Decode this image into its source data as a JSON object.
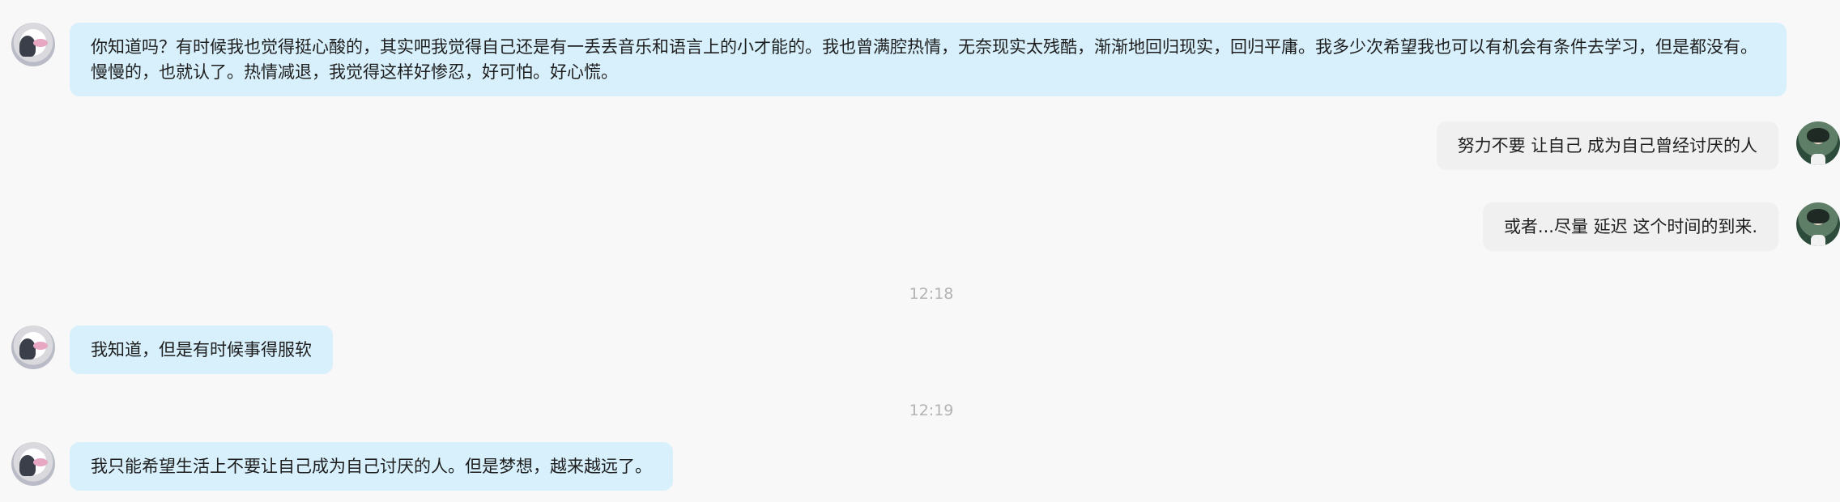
{
  "messages": [
    {
      "side": "left",
      "text": "你知道吗？有时候我也觉得挺心酸的，其实吧我觉得自己还是有一丢丢音乐和语言上的小才能的。我也曾满腔热情，无奈现实太残酷，渐渐地回归现实，回归平庸。我多少次希望我也可以有机会有条件去学习，但是都没有。慢慢的，也就认了。热情减退，我觉得这样好惨忍，好可怕。好心慌。"
    },
    {
      "side": "right",
      "text": "努力不要 让自己 成为自己曾经讨厌的人"
    },
    {
      "side": "right",
      "text": "或者...尽量 延迟 这个时间的到来."
    },
    {
      "side": "left",
      "text": "我知道，但是有时候事得服软"
    },
    {
      "side": "left",
      "text": "我只能希望生活上不要让自己成为自己讨厌的人。但是梦想，越来越远了。"
    }
  ],
  "timestamps": [
    "12:18",
    "12:19"
  ],
  "colors": {
    "background": "#f8f8f8",
    "incoming_bubble": "#d7f0fc",
    "outgoing_bubble": "#f0f0f0",
    "timestamp_text": "#b3b3b3"
  }
}
